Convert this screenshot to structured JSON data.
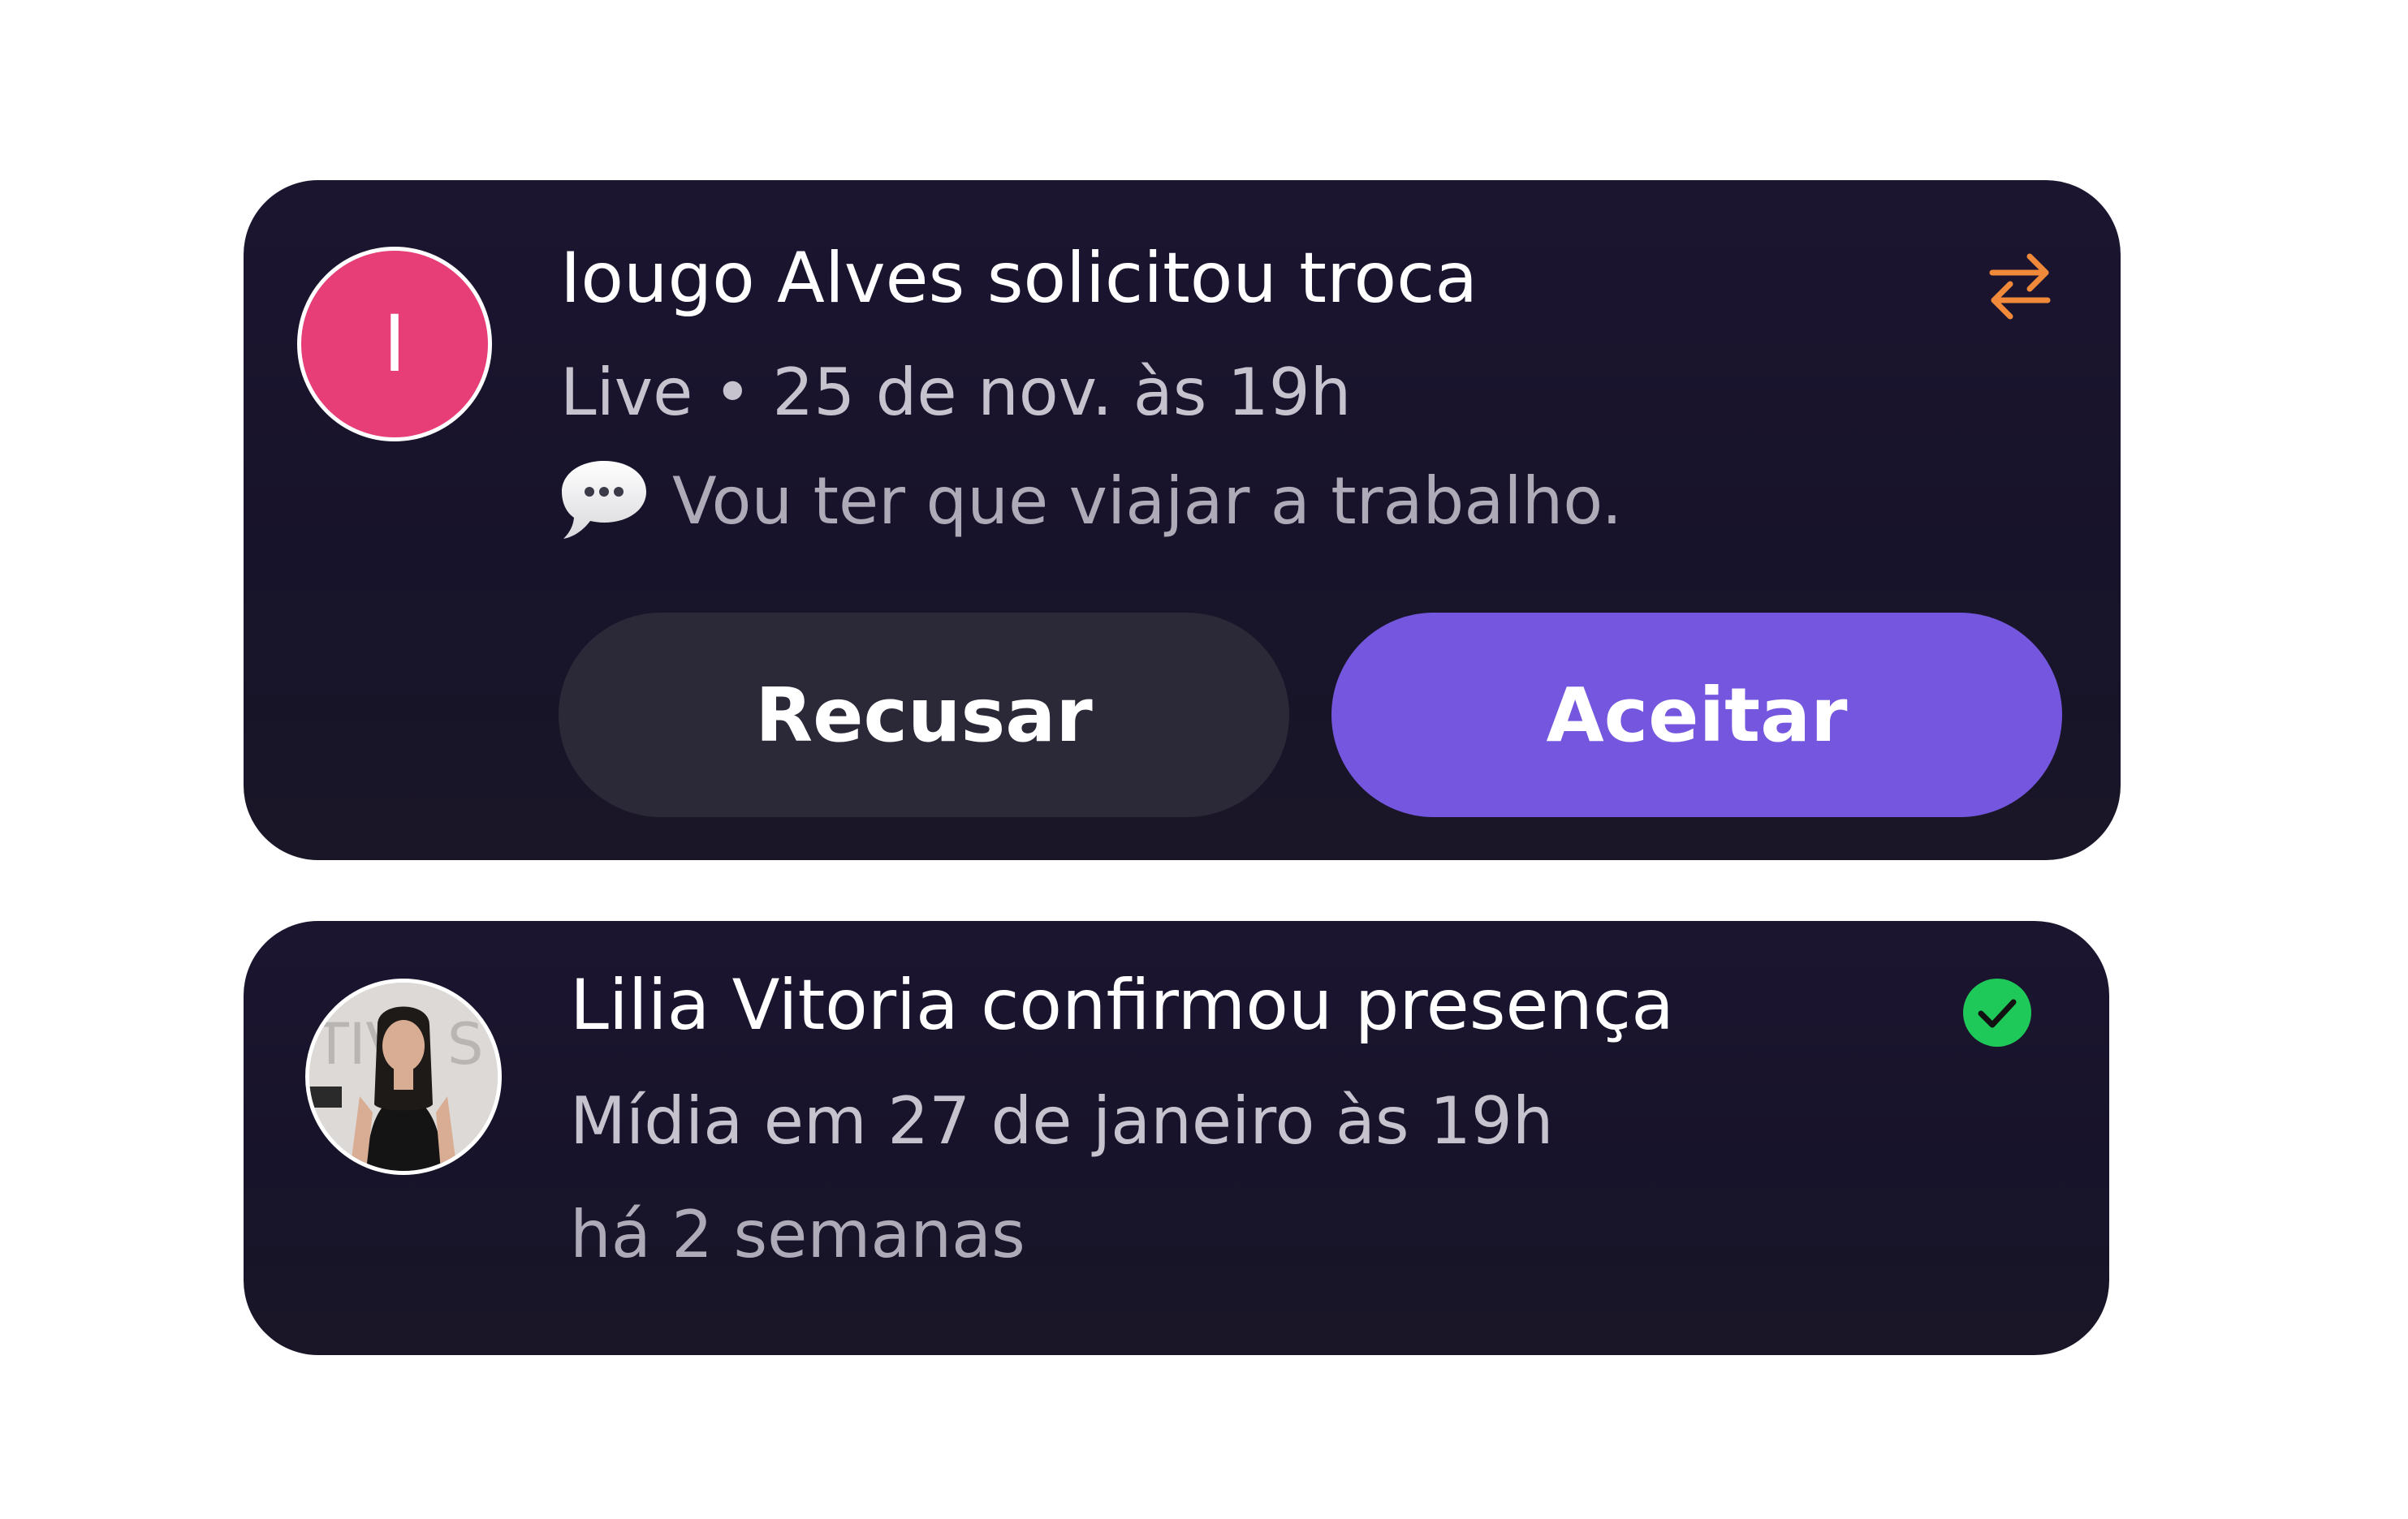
{
  "notifications": [
    {
      "avatar_initial": "I",
      "title": "Iougo Alves solicitou troca",
      "subtitle": "Live • 25 de nov. às 19h",
      "message": "Vou ter que viajar a trabalho.",
      "status_icon": "swap-arrows-icon",
      "decline_label": "Recusar",
      "accept_label": "Aceitar"
    },
    {
      "title": "Lilia Vitoria confirmou presença",
      "subtitle": "Mídia em 27 de janeiro às 19h",
      "time": "há 2 semanas",
      "status_icon": "check-circle-icon"
    }
  ],
  "colors": {
    "card_bg": "#1a1529",
    "avatar_initial_bg": "#e83e78",
    "accept_bg": "#7557df",
    "decline_bg": "#2b2838",
    "swap_icon": "#f08a3a",
    "check_icon": "#1ec95a"
  }
}
